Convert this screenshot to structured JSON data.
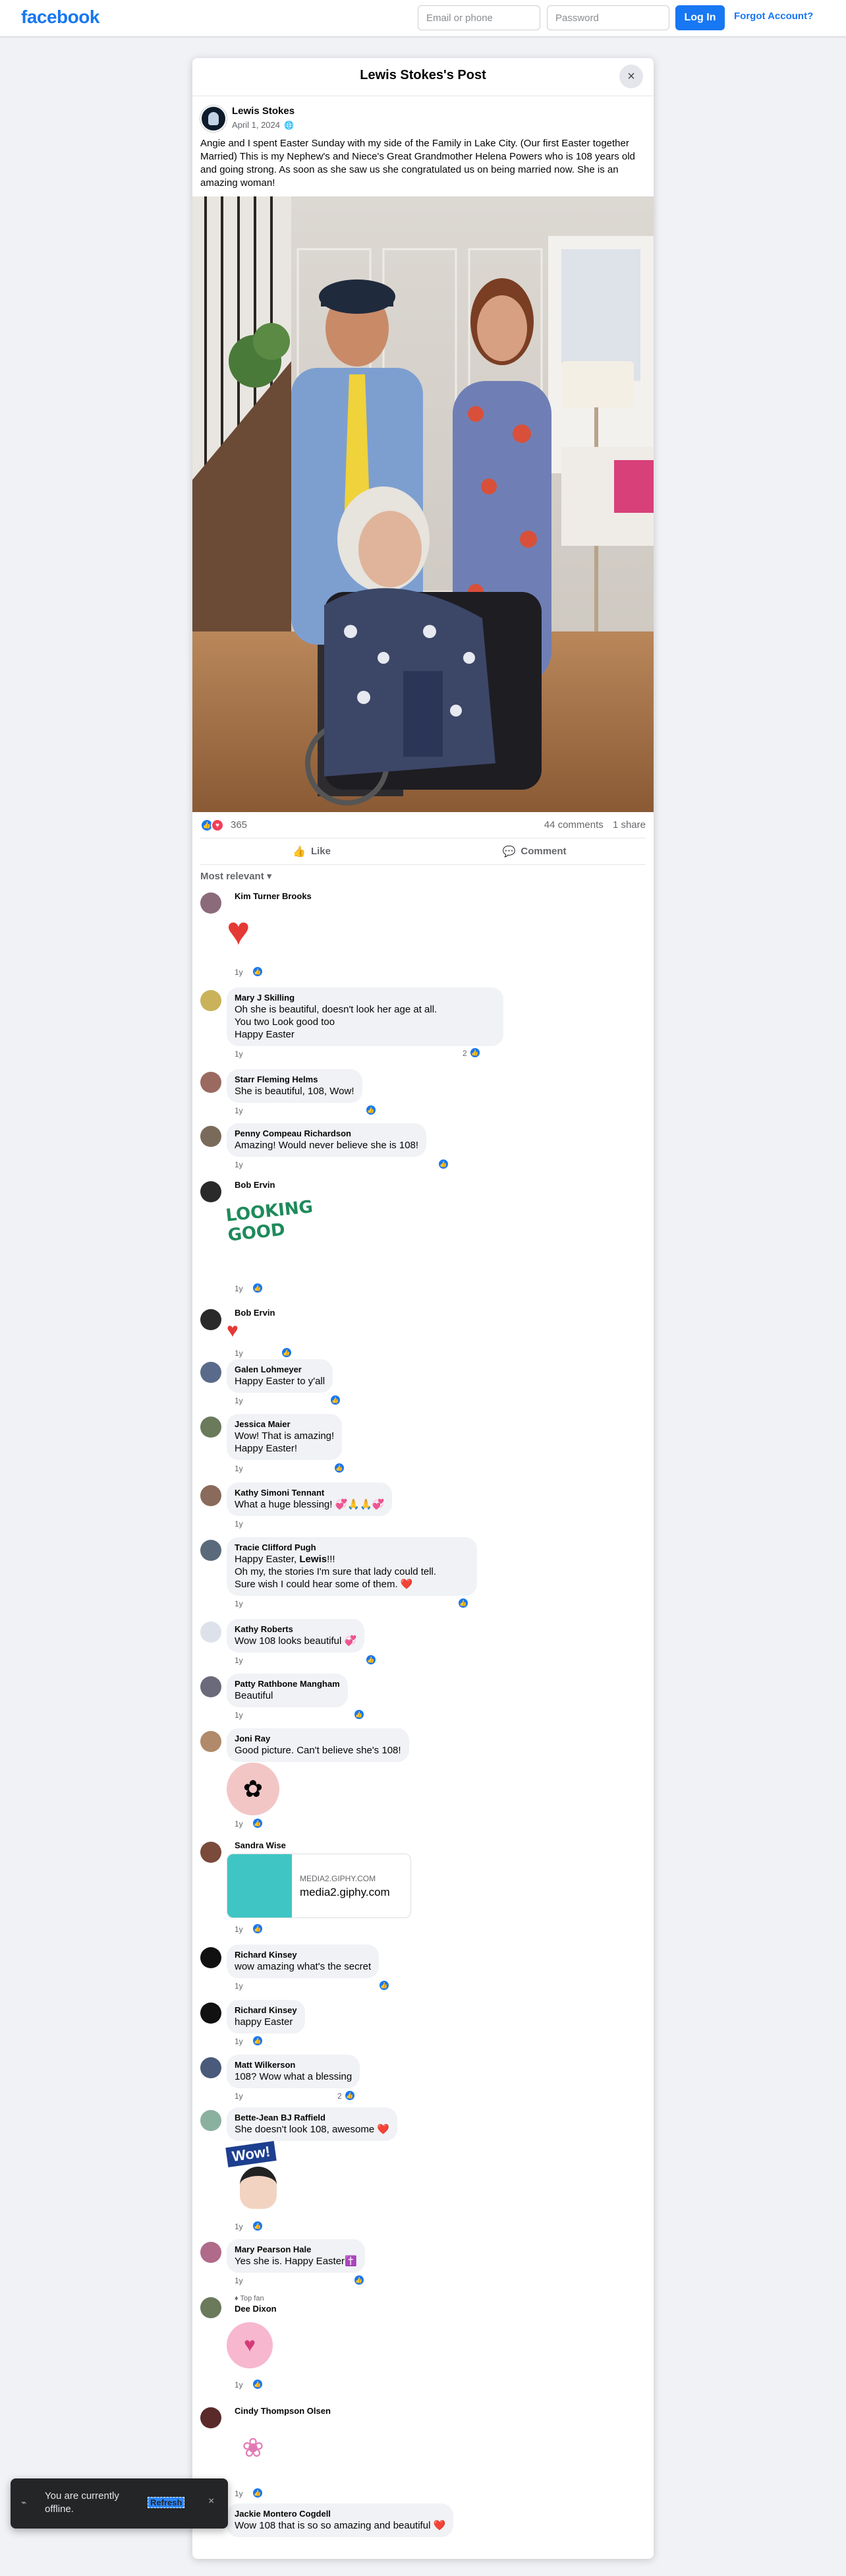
{
  "header": {
    "brand": "facebook",
    "email_placeholder": "Email or phone",
    "password_placeholder": "Password",
    "login_label": "Log In",
    "forgot_label": "Forgot Account?"
  },
  "post": {
    "title": "Lewis Stokes's Post",
    "close_icon": "×",
    "author": "Lewis Stokes",
    "date": "April 1, 2024",
    "privacy_icon": "globe-icon",
    "caption": "Angie and I spent Easter Sunday with my side of the Family in Lake City. (Our first Easter together Married) This is my Nephew's and Niece's Great Grandmother Helena Powers who is 108 years old and going strong. As soon as she saw us she congratulated us on being married now. She is an amazing woman!",
    "reaction_count": "365",
    "comments_count": "44 comments",
    "shares_count": "1 share",
    "like_label": "Like",
    "comment_label": "Comment",
    "sort_label": "Most relevant",
    "accent_color": "#1877f2"
  },
  "comments": [
    {
      "name": "Kim Turner Brooks",
      "text": "",
      "time": "1y",
      "likes": ""
    },
    {
      "name": "Mary J Skilling",
      "text": "Oh she is beautiful, doesn't look her age at all.\nYou two Look good too\nHappy Easter",
      "time": "1y",
      "likes": "2"
    },
    {
      "name": "Starr Fleming Helms",
      "text": "She is beautiful, 108, Wow!",
      "time": "1y",
      "likes": ""
    },
    {
      "name": "Penny Compeau Richardson",
      "text": "Amazing! Would never believe she is 108!",
      "time": "1y",
      "likes": ""
    },
    {
      "name": "Bob Ervin",
      "text": "",
      "sticker": "LOOKING GOOD",
      "time": "1y",
      "likes": ""
    },
    {
      "name": "Bob Ervin",
      "text": "",
      "time": "1y",
      "likes": ""
    },
    {
      "name": "Galen Lohmeyer",
      "text": "Happy Easter to y'all",
      "time": "1y",
      "likes": ""
    },
    {
      "name": "Jessica Maier",
      "text": "Wow! That is amazing!\nHappy Easter!",
      "time": "1y",
      "likes": ""
    },
    {
      "name": "Kathy Simoni Tennant",
      "text": "What a huge blessing! 💞🙏🙏💞",
      "time": "1y",
      "likes": ""
    },
    {
      "name": "Tracie Clifford Pugh",
      "text_pre": "Happy Easter, ",
      "mention": "Lewis",
      "text": "!!!\nOh my, the stories I'm sure that lady could tell.\nSure wish I could hear some of them. ❤️",
      "time": "1y",
      "likes": ""
    },
    {
      "name": "Kathy Roberts",
      "text": "Wow 108 looks beautiful 💞",
      "time": "1y",
      "likes": ""
    },
    {
      "name": "Patty Rathbone Mangham",
      "text": "Beautiful",
      "time": "1y",
      "likes": ""
    },
    {
      "name": "Joni Ray",
      "text": "Good picture. Can't believe she's 108!",
      "time": "1y",
      "likes": ""
    },
    {
      "name": "Sandra Wise",
      "link_domain": "MEDIA2.GIPHY.COM",
      "link_title": "media2.giphy.com",
      "time": "1y",
      "likes": ""
    },
    {
      "name": "Richard Kinsey",
      "text": "wow amazing what's the secret",
      "time": "1y",
      "likes": ""
    },
    {
      "name": "Richard Kinsey",
      "text": "happy Easter",
      "time": "1y",
      "likes": ""
    },
    {
      "name": "Matt Wilkerson",
      "text": "108? Wow what a blessing",
      "time": "1y",
      "likes": "2"
    },
    {
      "name": "Bette-Jean BJ Raffield",
      "text": "She doesn't look 108, awesome ❤️",
      "sticker": "Wow!",
      "time": "1y",
      "likes": ""
    },
    {
      "name": "Mary Pearson Hale",
      "text": "Yes she is. Happy Easter✝️",
      "time": "1y",
      "likes": ""
    },
    {
      "name": "Dee Dixon",
      "badge": "Top fan",
      "time": "1y",
      "likes": ""
    },
    {
      "name": "Cindy Thompson Olsen",
      "time": "1y",
      "likes": ""
    },
    {
      "name": "Jackie Montero Cogdell",
      "text": "Wow 108 that is so so amazing and beautiful ❤️",
      "time": "",
      "likes": ""
    }
  ],
  "toast": {
    "text": "You are currently offline.",
    "refresh": "Refresh",
    "close": "×"
  }
}
